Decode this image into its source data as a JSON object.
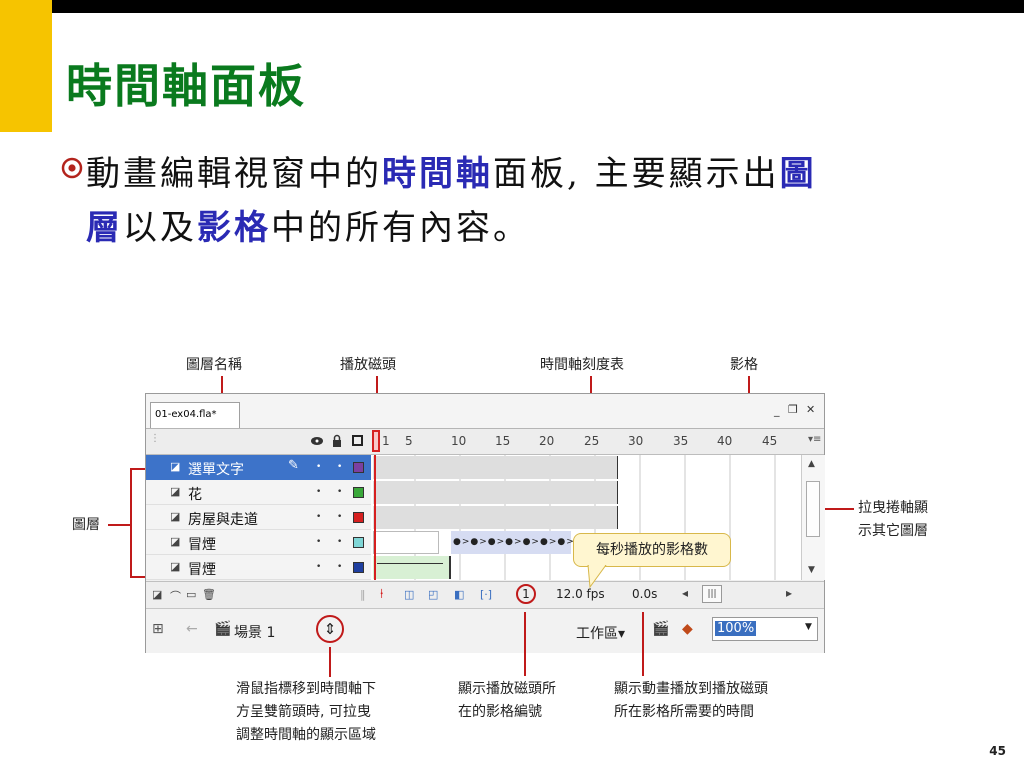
{
  "slide": {
    "title": "時間軸面板",
    "body_line1_a": "動畫編輯視窗中的",
    "body_line1_b": "時間軸",
    "body_line1_c": "面板, 主要顯示出",
    "body_line1_d": "圖",
    "body_line2_a": "層",
    "body_line2_b": "以及",
    "body_line2_c": "影格",
    "body_line2_d": "中的所有內容。",
    "page_number": "45"
  },
  "annotations": {
    "layer_name": "圖層名稱",
    "playhead": "播放磁頭",
    "ruler": "時間軸刻度表",
    "frame": "影格",
    "layers": "圖層",
    "scrollbar_line1": "拉曳捲軸顯",
    "scrollbar_line2": "示其它圖層",
    "fps_callout": "每秒播放的影格數",
    "bottom_left_1": "滑鼠指標移到時間軸下",
    "bottom_left_2": "方呈雙箭頭時, 可拉曳",
    "bottom_left_3": "調整時間軸的顯示區域",
    "bottom_mid_1": "顯示播放磁頭所",
    "bottom_mid_2": "在的影格編號",
    "bottom_right_1": "顯示動畫播放到播放磁頭",
    "bottom_right_2": "所在影格所需要的時間"
  },
  "panel": {
    "tab_label": "01-ex04.fla*",
    "ruler_marks": [
      "1",
      "5",
      "10",
      "15",
      "20",
      "25",
      "30",
      "35",
      "40",
      "45"
    ],
    "layers": [
      {
        "name": "選單文字",
        "color": "#7b3fa0",
        "selected": true
      },
      {
        "name": "花",
        "color": "#3aa83a",
        "selected": false
      },
      {
        "name": "房屋與走道",
        "color": "#d62020",
        "selected": false
      },
      {
        "name": "冒煙",
        "color": "#7fd6d6",
        "selected": false
      },
      {
        "name": "冒煙",
        "color": "#1f3fa0",
        "selected": false
      }
    ],
    "current_frame": "1",
    "fps": "12.0 fps",
    "elapsed": "0.0s",
    "scene_label": "場景 1",
    "workspace_label": "工作區",
    "zoom_value": "100%"
  },
  "colors": {
    "title_green": "#0a7a1e",
    "highlight_blue": "#2a2ab4",
    "accent_yellow": "#f6c400",
    "annotation_red": "#c01a1a"
  }
}
